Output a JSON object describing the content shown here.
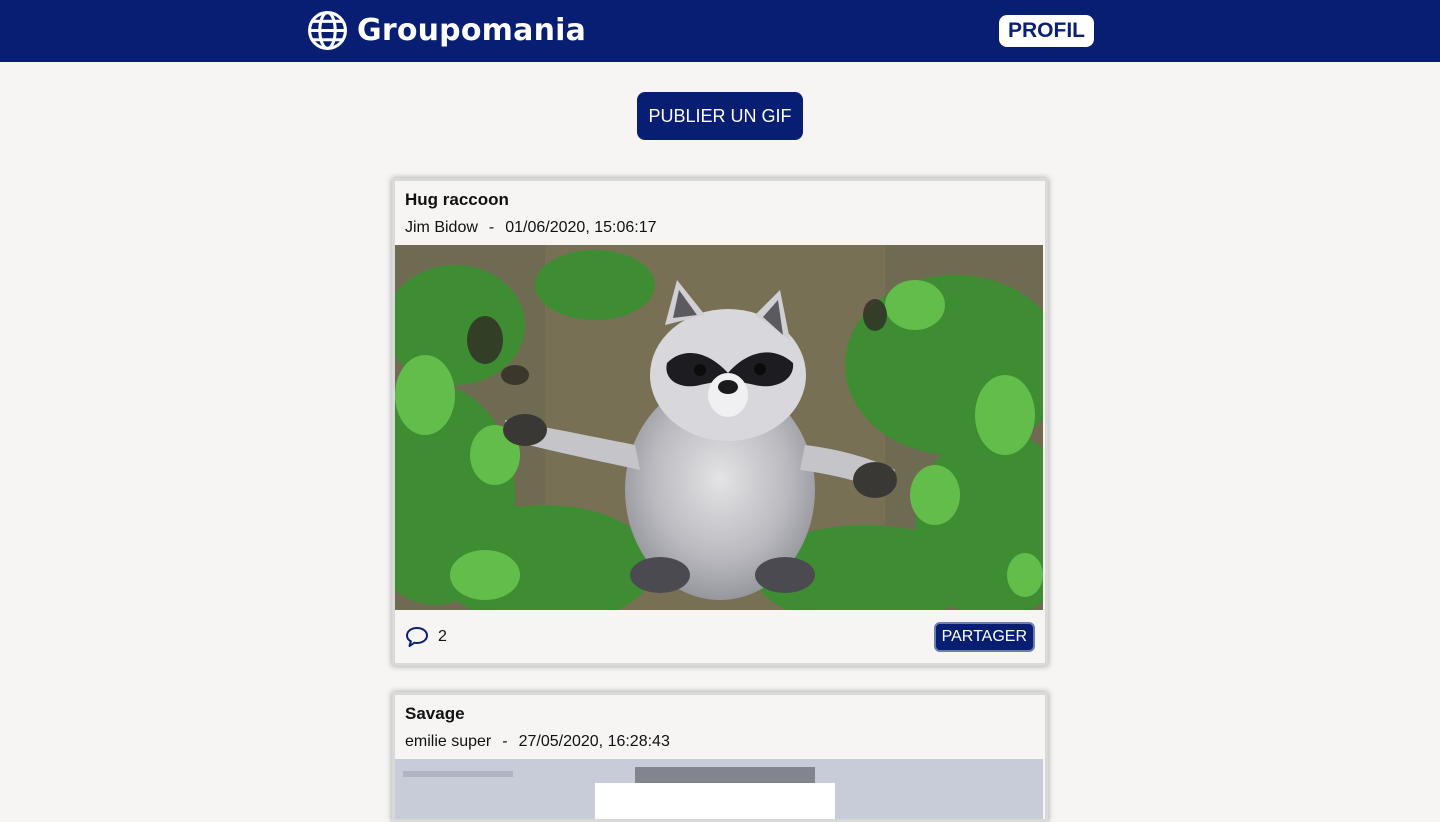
{
  "header": {
    "brand_name": "Groupomania",
    "profile_label": "PROFIL",
    "colors": {
      "bar": "#081e73",
      "button_text": "#0b1f73"
    }
  },
  "toolbar": {
    "publish_label": "PUBLIER UN GIF"
  },
  "posts": [
    {
      "title": "Hug raccoon",
      "author": "Jim Bidow",
      "separator": "-",
      "date": "01/06/2020, 15:06:17",
      "comment_count": "2",
      "share_label": "PARTAGER",
      "media_icon": "raccoon-gif"
    },
    {
      "title": "Savage",
      "author": "emilie super",
      "separator": "-",
      "date": "27/05/2020, 16:28:43",
      "media_icon": "savage-gif"
    }
  ]
}
